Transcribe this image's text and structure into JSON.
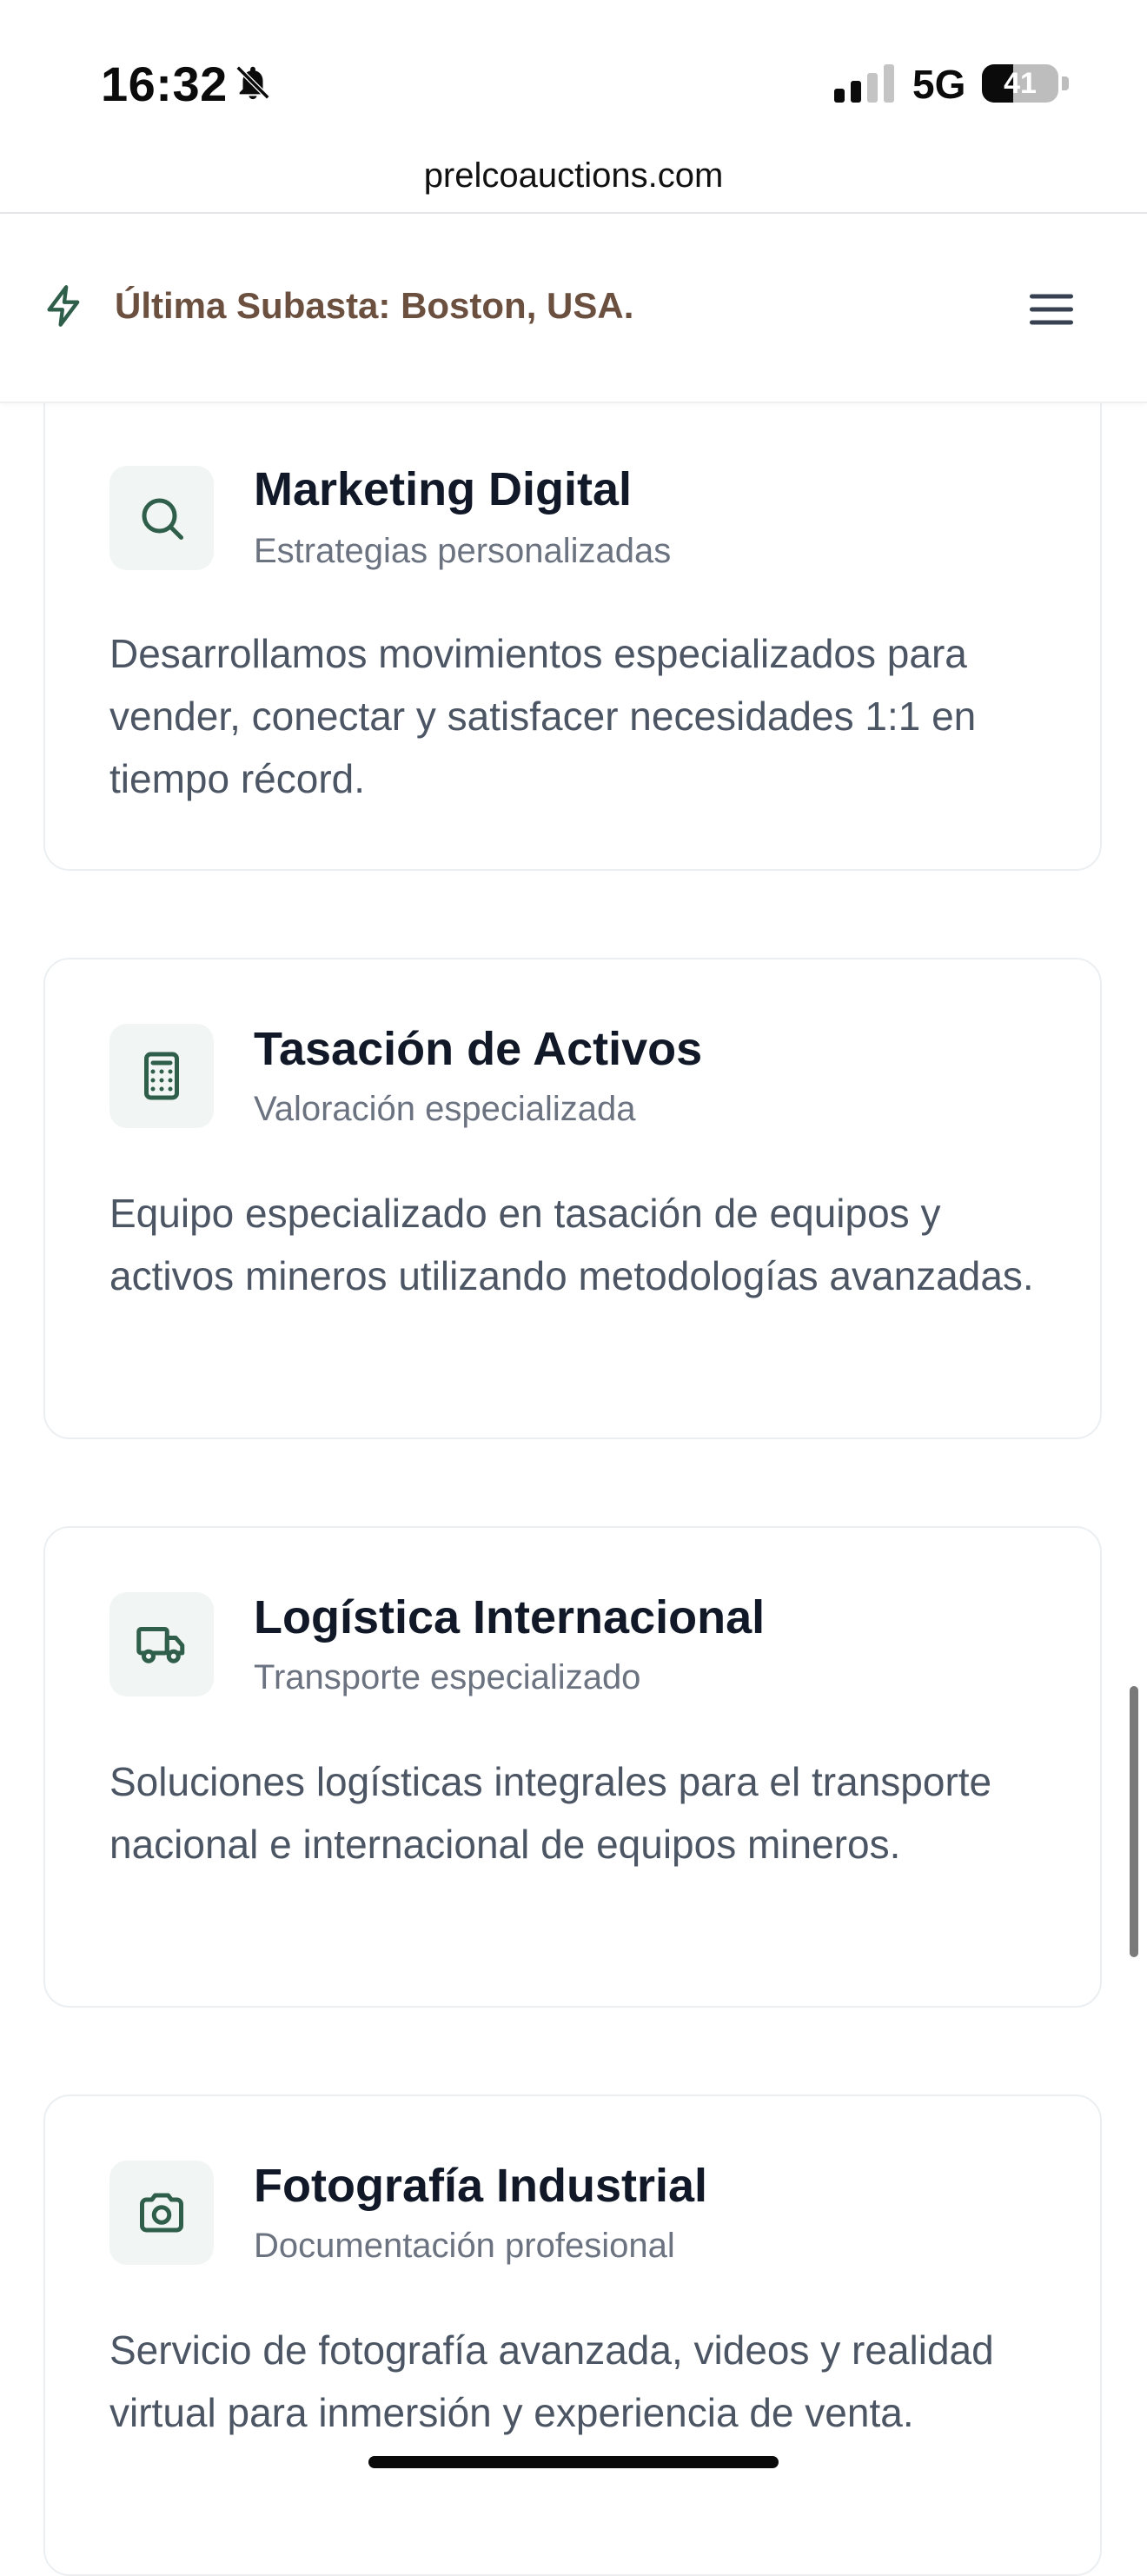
{
  "status_bar": {
    "time": "16:32",
    "network": "5G",
    "battery_level": "41",
    "battery_fraction": 0.41,
    "icons": [
      "bell-slash-icon",
      "signal-bars-icon",
      "battery-icon"
    ]
  },
  "browser": {
    "url": "prelcoauctions.com"
  },
  "header": {
    "announcement": "Última Subasta: Boston, USA.",
    "icons": [
      "bolt-icon",
      "hamburger-menu-icon"
    ]
  },
  "services": [
    {
      "icon": "search-icon",
      "title": "Marketing Digital",
      "subtitle": "Estrategias personalizadas",
      "description": "Desarrollamos movimientos especializados para vender, conectar y satisfacer necesidades 1:1 en tiempo récord."
    },
    {
      "icon": "calculator-icon",
      "title": "Tasación de Activos",
      "subtitle": "Valoración especializada",
      "description": "Equipo especializado en tasación de equipos y activos mineros utilizando metodologías avanzadas."
    },
    {
      "icon": "truck-icon",
      "title": "Logística Internacional",
      "subtitle": "Transporte especializado",
      "description": "Soluciones logísticas integrales para el transporte nacional e internacional de equipos mineros."
    },
    {
      "icon": "camera-icon",
      "title": "Fotografía Industrial",
      "subtitle": "Documentación profesional",
      "description": "Servicio de fotografía avanzada, videos y realidad virtual para inmersión y experiencia de venta."
    }
  ],
  "colors": {
    "accent_green": "#2f5e4a",
    "announcement_brown": "#6b4f3f",
    "icon_tile_bg": "#f1f5f3"
  }
}
